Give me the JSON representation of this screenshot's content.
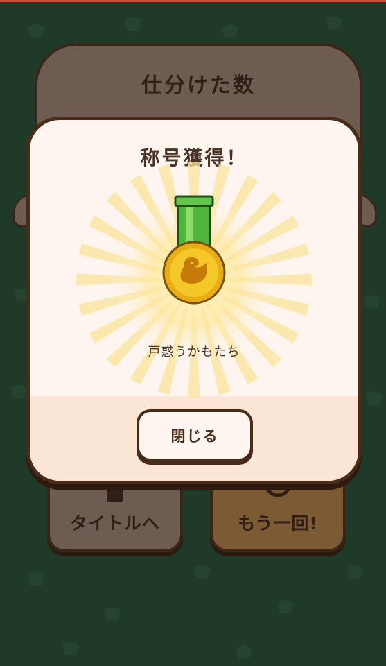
{
  "background": {
    "panel_title": "仕分けた数",
    "title_button_label": "タイトルへ",
    "retry_button_label": "もう一回!"
  },
  "modal": {
    "heading": "称号獲得！",
    "medal_icon": "duck-medal-icon",
    "title_name": "戸惑うかもたち",
    "close_label": "閉じる"
  },
  "colors": {
    "background": "#1f3a27",
    "panel_dark": "#6e5c52",
    "outline": "#4a2a18",
    "modal_bg": "#fdf5ee",
    "medal_gold": "#f0c020",
    "ribbon_green": "#4fb53c"
  }
}
